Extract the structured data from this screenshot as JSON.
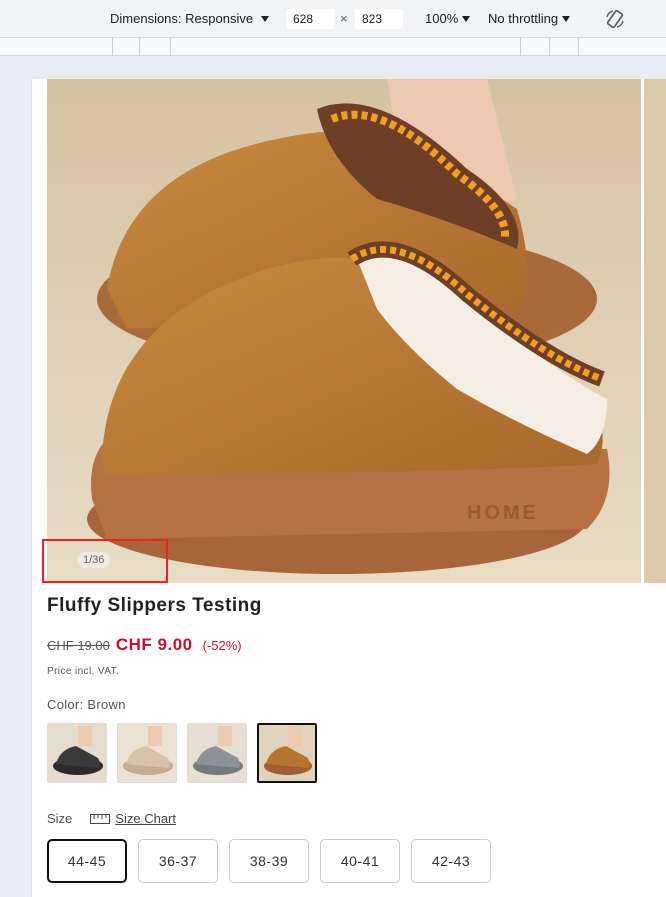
{
  "devtools": {
    "dimensions_label": "Dimensions: Responsive",
    "width_value": "628",
    "times": "×",
    "height_value": "823",
    "zoom": "100%",
    "throttling": "No throttling",
    "rotate_icon": "rotate-device-icon"
  },
  "product": {
    "gallery_counter": "1/36",
    "title": "Fluffy Slippers Testing",
    "old_price": "CHF 19.00",
    "new_price": "CHF 9.00",
    "discount": "(-52%)",
    "vat_note": "Price incl. VAT.",
    "color_label": "Color: Brown",
    "colors": [
      {
        "name": "black",
        "hex": "#2b2b2b"
      },
      {
        "name": "beige",
        "hex": "#d8c3a8"
      },
      {
        "name": "grey",
        "hex": "#8e9296"
      },
      {
        "name": "brown",
        "hex": "#b8742e"
      }
    ],
    "size_label": "Size",
    "size_chart_label": "Size Chart",
    "sizes": [
      "44-45",
      "36-37",
      "38-39",
      "40-41",
      "42-43"
    ],
    "selected_size": "44-45"
  }
}
